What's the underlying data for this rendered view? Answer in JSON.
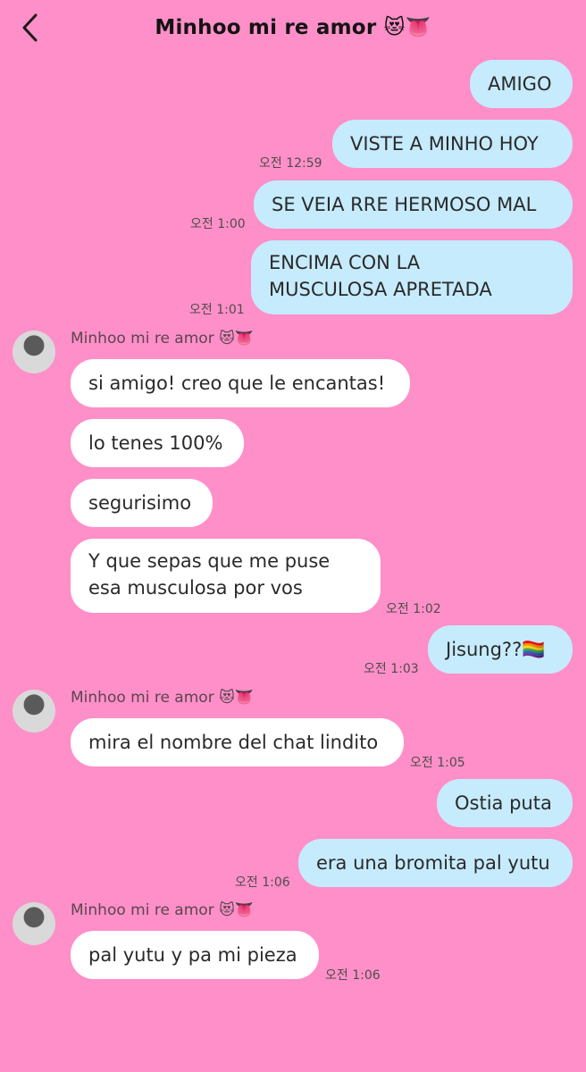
{
  "header": {
    "title": "Minhoo mi re amor 😻👅"
  },
  "contact_name": "Minhoo mi re amor 😻👅",
  "messages": [
    {
      "dir": "out",
      "text": "AMIGO",
      "time": ""
    },
    {
      "dir": "out",
      "text": "VISTE A MINHO HOY",
      "time": "오전 12:59"
    },
    {
      "dir": "out",
      "text": "SE VEIA RRE HERMOSO MAL",
      "time": "오전 1:00"
    },
    {
      "dir": "out",
      "text_lines": [
        "ENCIMA CON LA",
        "MUSCULOSA APRETADA"
      ],
      "time": "오전 1:01"
    },
    {
      "dir": "in",
      "text": "si amigo! creo que le encantas!",
      "time": ""
    },
    {
      "dir": "in",
      "text": "lo tenes 100%",
      "time": ""
    },
    {
      "dir": "in",
      "text": "segurisimo",
      "time": ""
    },
    {
      "dir": "in",
      "text_lines": [
        "Y que sepas que me puse",
        "esa musculosa por vos"
      ],
      "time": "오전 1:02"
    },
    {
      "dir": "out",
      "text": "Jisung??🏳️‍🌈",
      "time": "오전 1:03"
    },
    {
      "dir": "in",
      "text": "mira el nombre del chat lindito",
      "time": "오전 1:05"
    },
    {
      "dir": "out",
      "text": "Ostia puta",
      "time": ""
    },
    {
      "dir": "out",
      "text": "era una bromita pal yutu",
      "time": "오전 1:06"
    },
    {
      "dir": "in",
      "text": "pal yutu y pa mi pieza",
      "time": "오전 1:06"
    }
  ]
}
